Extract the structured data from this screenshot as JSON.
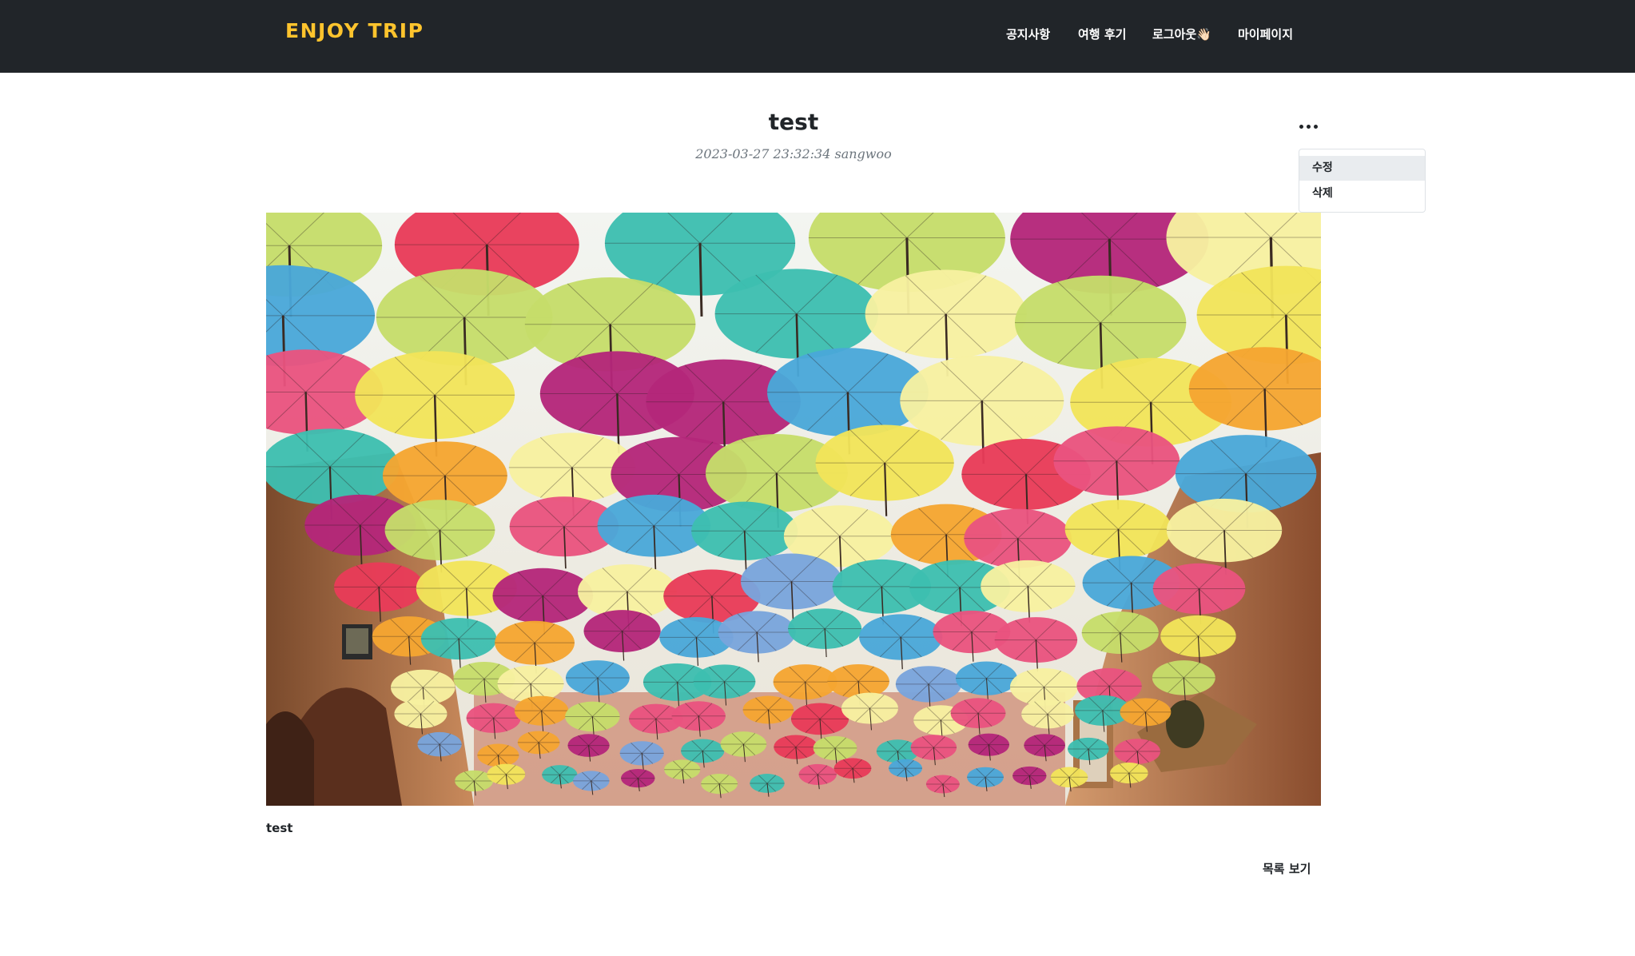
{
  "navbar": {
    "brand": "ENJOY TRIP",
    "links": [
      "공지사항",
      "여행 후기",
      "로그아웃👋🏻",
      "마이페이지"
    ]
  },
  "post": {
    "title": "test",
    "meta": "2023-03-27 23:32:34 sangwoo",
    "content": "test",
    "image_alt": "colorful umbrellas photo"
  },
  "menu": {
    "icon": "more-horizontal-icon",
    "items": [
      "수정",
      "삭제"
    ]
  },
  "footer": {
    "list_label": "목록 보기"
  },
  "colors": {
    "navbar_bg": "#212529",
    "brand": "#fec42d",
    "menu_highlight": "#e9ecef"
  }
}
